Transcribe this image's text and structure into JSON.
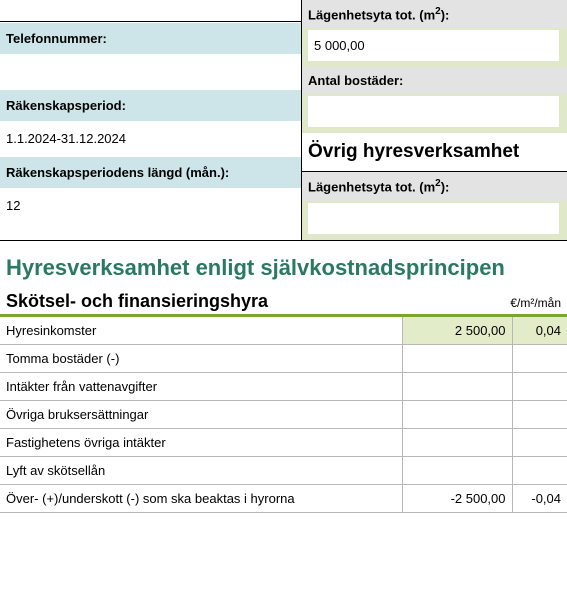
{
  "left": {
    "blank_top": "",
    "telefon_label": "Telefonnummer:",
    "telefon_value": "",
    "rak_period_label": "Räkenskapsperiod:",
    "rak_period_value": "1.1.2024-31.12.2024",
    "rak_len_label": "Räkenskapsperiodens längd (mån.):",
    "rak_len_value": "12"
  },
  "right": {
    "area_label_prefix": "Lägenhetsyta tot. (m",
    "area_label_suffix": "):",
    "area_value": "5 000,00",
    "antal_label": "Antal bostäder:",
    "antal_value": "",
    "ovrig_title": "Övrig hyresverksamhet",
    "area2_label_prefix": "Lägenhetsyta tot. (m",
    "area2_label_suffix": "):",
    "area2_value": ""
  },
  "main_title": "Hyresverksamhet enligt självkostnadsprincipen",
  "section_title": "Skötsel- och finansieringshyra",
  "unit_header": "€/m²/mån",
  "rows": [
    {
      "label": "Hyresinkomster",
      "v1": "2 500,00",
      "v2": "0,04",
      "hl": true
    },
    {
      "label": "Tomma bostäder (-)",
      "v1": "",
      "v2": "",
      "hl": false
    },
    {
      "label": "Intäkter från vattenavgifter",
      "v1": "",
      "v2": "",
      "hl": false
    },
    {
      "label": "Övriga bruksersättningar",
      "v1": "",
      "v2": "",
      "hl": false
    },
    {
      "label": "Fastighetens övriga intäkter",
      "v1": "",
      "v2": "",
      "hl": false
    },
    {
      "label": "Lyft av skötsellån",
      "v1": "",
      "v2": "",
      "hl": false
    },
    {
      "label": "Över- (+)/underskott (-) som ska beaktas i hyrorna",
      "v1": "-2 500,00",
      "v2": "-0,04",
      "hl": false
    }
  ]
}
